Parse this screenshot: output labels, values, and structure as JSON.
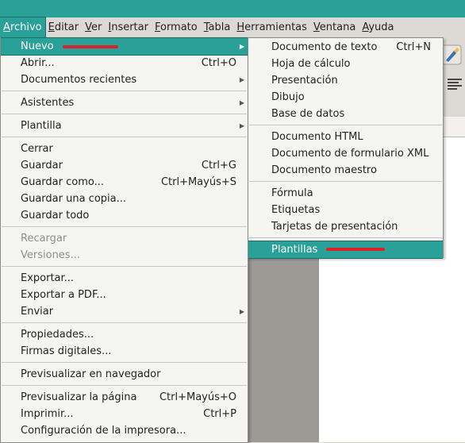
{
  "menubar": {
    "items": [
      {
        "label": "Archivo",
        "u": "A",
        "rest": "rchivo"
      },
      {
        "label": "Editar",
        "u": "E",
        "rest": "ditar"
      },
      {
        "label": "Ver",
        "u": "V",
        "rest": "er"
      },
      {
        "label": "Insertar",
        "u": "I",
        "rest": "nsertar"
      },
      {
        "label": "Formato",
        "u": "F",
        "rest": "ormato"
      },
      {
        "label": "Tabla",
        "u": "T",
        "rest": "abla"
      },
      {
        "label": "Herramientas",
        "u": "H",
        "rest": "erramientas"
      },
      {
        "label": "Ventana",
        "u": "V",
        "rest": "entana"
      },
      {
        "label": "Ayuda",
        "u": "A",
        "rest": "yuda"
      }
    ]
  },
  "file_menu": {
    "nuevo": {
      "label": "Nuevo"
    },
    "abrir": {
      "label": "Abrir...",
      "accel": "Ctrl+O"
    },
    "recientes": {
      "label": "Documentos recientes"
    },
    "asistentes": {
      "label": "Asistentes"
    },
    "plantilla": {
      "label": "Plantilla"
    },
    "cerrar": {
      "label": "Cerrar"
    },
    "guardar": {
      "label": "Guardar",
      "accel": "Ctrl+G"
    },
    "guardar_como": {
      "label": "Guardar como...",
      "accel": "Ctrl+Mayús+S"
    },
    "guardar_copia": {
      "label": "Guardar una copia..."
    },
    "guardar_todo": {
      "label": "Guardar todo"
    },
    "recargar": {
      "label": "Recargar"
    },
    "versiones": {
      "label": "Versiones..."
    },
    "exportar": {
      "label": "Exportar..."
    },
    "exportar_pdf": {
      "label": "Exportar a PDF..."
    },
    "enviar": {
      "label": "Enviar"
    },
    "propiedades": {
      "label": "Propiedades..."
    },
    "firmas": {
      "label": "Firmas digitales..."
    },
    "previs_nav": {
      "label": "Previsualizar en navegador"
    },
    "previs_pag": {
      "label": "Previsualizar la página",
      "accel": "Ctrl+Mayús+O"
    },
    "imprimir": {
      "label": "Imprimir...",
      "accel": "Ctrl+P"
    },
    "config_impr": {
      "label": "Configuración de la impresora..."
    }
  },
  "new_menu": {
    "doc_texto": {
      "label": "Documento de texto",
      "accel": "Ctrl+N"
    },
    "hoja": {
      "label": "Hoja de cálculo"
    },
    "presentacion": {
      "label": "Presentación"
    },
    "dibujo": {
      "label": "Dibujo"
    },
    "base": {
      "label": "Base de datos"
    },
    "html": {
      "label": "Documento HTML"
    },
    "form_xml": {
      "label": "Documento de formulario XML"
    },
    "maestro": {
      "label": "Documento maestro"
    },
    "formula": {
      "label": "Fórmula"
    },
    "etiquetas": {
      "label": "Etiquetas"
    },
    "tarjetas": {
      "label": "Tarjetas de presentación"
    },
    "plantillas": {
      "label": "Plantillas"
    }
  },
  "colors": {
    "accent": "#2aa198",
    "highlight_mark": "#d9232a"
  }
}
